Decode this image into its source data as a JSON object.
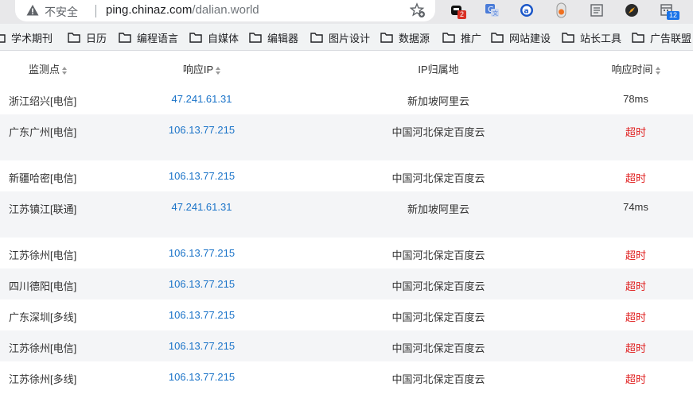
{
  "browser": {
    "insecure_label": "不安全",
    "url_host": "ping.chinaz.com",
    "url_path": "/dalian.world",
    "extensions": [
      {
        "name": "ext-1",
        "badge": "2",
        "badge_color": "#d93025"
      },
      {
        "name": "translate"
      },
      {
        "name": "a-ext"
      },
      {
        "name": "ext-orange"
      },
      {
        "name": "reader"
      },
      {
        "name": "compass"
      },
      {
        "name": "calendar",
        "badge": "12",
        "badge_color": "#1a73e8"
      }
    ]
  },
  "bookmarks": [
    "学术期刊",
    "日历",
    "编程语言",
    "自媒体",
    "编辑器",
    "图片设计",
    "数据源",
    "推广",
    "网站建设",
    "站长工具",
    "广告联盟"
  ],
  "table": {
    "headers": [
      "监测点",
      "响应IP",
      "IP归属地",
      "响应时间"
    ],
    "rows": [
      {
        "node": "浙江绍兴[电信]",
        "ip": "47.241.61.31",
        "location": "新加坡阿里云",
        "time": "78ms",
        "timeout": false
      },
      {
        "node": "广东广州[电信]",
        "ip": "106.13.77.215",
        "location": "中国河北保定百度云",
        "time": "超时",
        "timeout": true
      },
      {
        "node": "新疆哈密[电信]",
        "ip": "106.13.77.215",
        "location": "中国河北保定百度云",
        "time": "超时",
        "timeout": true
      },
      {
        "node": "江苏镇江[联通]",
        "ip": "47.241.61.31",
        "location": "新加坡阿里云",
        "time": "74ms",
        "timeout": false
      },
      {
        "node": "江苏徐州[电信]",
        "ip": "106.13.77.215",
        "location": "中国河北保定百度云",
        "time": "超时",
        "timeout": true
      },
      {
        "node": "四川德阳[电信]",
        "ip": "106.13.77.215",
        "location": "中国河北保定百度云",
        "time": "超时",
        "timeout": true
      },
      {
        "node": "广东深圳[多线]",
        "ip": "106.13.77.215",
        "location": "中国河北保定百度云",
        "time": "超时",
        "timeout": true
      },
      {
        "node": "江苏徐州[电信]",
        "ip": "106.13.77.215",
        "location": "中国河北保定百度云",
        "time": "超时",
        "timeout": true
      },
      {
        "node": "江苏徐州[多线]",
        "ip": "106.13.77.215",
        "location": "中国河北保定百度云",
        "time": "超时",
        "timeout": true
      }
    ]
  },
  "colors": {
    "link": "#1a73c8",
    "timeout": "#e02020",
    "alt_row": "#f4f5f7"
  }
}
